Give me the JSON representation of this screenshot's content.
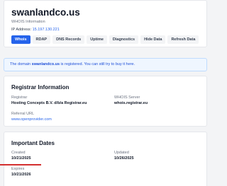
{
  "header": {
    "domain": "swanlandco.us",
    "subtitle": "WHOIS Information",
    "ip_label": "IP Address:",
    "ip_value": "15.197.130.221"
  },
  "tabs": [
    {
      "label": "Whois",
      "active": true
    },
    {
      "label": "RDAP"
    },
    {
      "label": "DNS Records"
    },
    {
      "label": "Uptime"
    },
    {
      "label": "Diagnostics"
    },
    {
      "label": "Hide Data"
    },
    {
      "label": "Refresh Data"
    }
  ],
  "notice": {
    "prefix": "The domain ",
    "domain": "swanlandco.us",
    "suffix": " is registered. You can still try to buy it here."
  },
  "registrar": {
    "title": "Registrar Information",
    "registrar_label": "Registrar",
    "registrar_value": "Hosting Concepts B.V. d/b/a Registrar.eu",
    "whois_server_label": "WHOIS Server",
    "whois_server_value": "whois.registrar.eu",
    "referral_label": "Referral URL",
    "referral_value": "www.openprovider.com"
  },
  "dates": {
    "title": "Important Dates",
    "created_label": "Created",
    "created_value": "10/21/2025",
    "updated_label": "Updated",
    "updated_value": "10/26/2025",
    "expires_label": "Expires",
    "expires_value": "10/21/2026"
  },
  "colors": {
    "accent": "#2563eb",
    "annotation": "#d32f2f"
  }
}
